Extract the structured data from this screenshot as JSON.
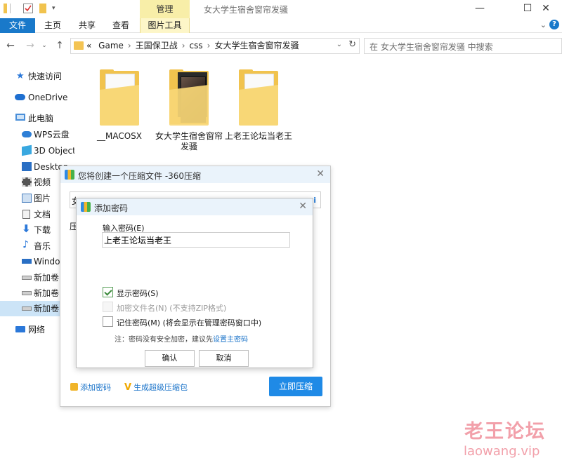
{
  "window": {
    "title": "女大学生宿舍窗帘发骚",
    "context_tab": "管理",
    "controls": [
      "—",
      "☐",
      "✕"
    ]
  },
  "ribbon": {
    "tabs": [
      "文件",
      "主页",
      "共享",
      "查看",
      "图片工具"
    ],
    "help": "?"
  },
  "navigation": {
    "breadcrumb": [
      "Game",
      "王国保卫战",
      "css",
      "女大学生宿舍窗帘发骚"
    ],
    "prefix": "«",
    "search_placeholder": "在 女大学生宿舍窗帘发骚 中搜索"
  },
  "sidebar": {
    "items": [
      {
        "label": "快速访问",
        "icon": "star-icon",
        "color": "#2b78d9"
      },
      {
        "label": "OneDrive",
        "icon": "cloud-icon",
        "color": "#1e6fd0"
      },
      {
        "label": "此电脑",
        "icon": "computer-icon",
        "color": "#4a8fd9"
      },
      {
        "label": "WPS云盘",
        "icon": "cloud-icon",
        "color": "#2e7fd6"
      },
      {
        "label": "3D Object",
        "icon": "cube-icon",
        "color": "#39a8e0"
      },
      {
        "label": "Desktop",
        "icon": "desktop-icon",
        "color": "#2a6fc4"
      },
      {
        "label": "视频",
        "icon": "video-icon",
        "color": "#555555"
      },
      {
        "label": "图片",
        "icon": "picture-icon",
        "color": "#4b80bf"
      },
      {
        "label": "文档",
        "icon": "document-icon",
        "color": "#6a6a6a"
      },
      {
        "label": "下载",
        "icon": "download-icon",
        "color": "#2b78d9"
      },
      {
        "label": "音乐",
        "icon": "music-icon",
        "color": "#2b78d9"
      },
      {
        "label": "Windo",
        "icon": "drive-icon",
        "color": "#2a6fc4"
      },
      {
        "label": "新加卷",
        "icon": "drive-icon",
        "color": "#888888"
      },
      {
        "label": "新加卷",
        "icon": "drive-icon",
        "color": "#888888"
      },
      {
        "label": "新加卷",
        "icon": "drive-icon",
        "color": "#888888"
      },
      {
        "label": "网络",
        "icon": "network-icon",
        "color": "#2b78d9"
      }
    ]
  },
  "files": [
    {
      "name": "__MACOSX",
      "icon": "folder-icon"
    },
    {
      "name": "女大学生宿舍窗帘发骚",
      "icon": "folder-image-icon"
    },
    {
      "name": "上老王论坛当老王",
      "icon": "folder-icon"
    }
  ],
  "zip_dialog": {
    "title": "您将创建一个压缩文件 -360压缩",
    "field_stub": "女",
    "label_stub": "压",
    "add_password_link": "添加密码",
    "super_link": "生成超级压缩包",
    "compress_button": "立即压缩"
  },
  "password_dialog": {
    "title": "添加密码",
    "input_label": "输入密码(E)",
    "password_value": "上老王论坛当老王",
    "show_password": {
      "label": "显示密码(S)",
      "checked": true
    },
    "encrypt_names": {
      "label": "加密文件名(N) (不支持ZIP格式)",
      "checked": false,
      "disabled": true
    },
    "remember": {
      "label": "记住密码(M) (将会显示在管理密码窗口中)",
      "checked": false
    },
    "note": "注：密码没有安全加密，建议先",
    "note_link": "设置主密码",
    "ok_button": "确认",
    "cancel_button": "取消"
  },
  "watermark": {
    "line1": "老王论坛",
    "line2": "laowang.vip"
  }
}
